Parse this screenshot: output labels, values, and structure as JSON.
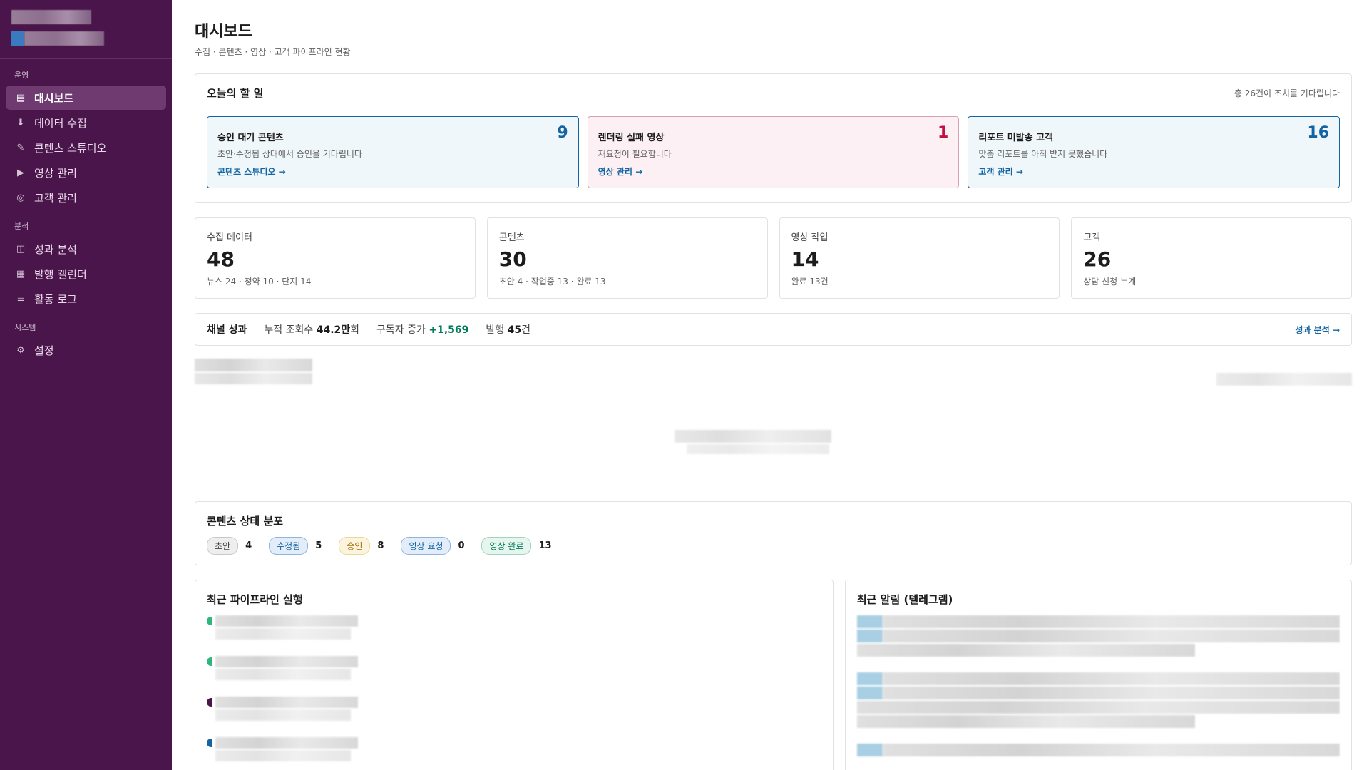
{
  "sidebar": {
    "sections": [
      {
        "label": "운영",
        "items": [
          {
            "id": "dashboard",
            "label": "대시보드",
            "icon": "dashboard-icon",
            "glyph": "▤",
            "active": true
          },
          {
            "id": "data",
            "label": "데이터 수집",
            "icon": "download-icon",
            "glyph": "⬇"
          },
          {
            "id": "content",
            "label": "콘텐츠 스튜디오",
            "icon": "pencil-icon",
            "glyph": "✎"
          },
          {
            "id": "video",
            "label": "영상 관리",
            "icon": "play-icon",
            "glyph": "▶"
          },
          {
            "id": "customers",
            "label": "고객 관리",
            "icon": "target-icon",
            "glyph": "◎"
          }
        ]
      },
      {
        "label": "분석",
        "items": [
          {
            "id": "analytics",
            "label": "성과 분석",
            "icon": "columns-icon",
            "glyph": "◫"
          },
          {
            "id": "calendar",
            "label": "발행 캘린더",
            "icon": "calendar-icon",
            "glyph": "▦"
          },
          {
            "id": "log",
            "label": "활동 로그",
            "icon": "list-icon",
            "glyph": "≡"
          }
        ]
      },
      {
        "label": "시스템",
        "items": [
          {
            "id": "settings",
            "label": "설정",
            "icon": "gear-icon",
            "glyph": "⚙"
          }
        ]
      }
    ]
  },
  "header": {
    "title": "대시보드",
    "subtitle": "수집 · 콘텐츠 · 영상 · 고객 파이프라인 현황"
  },
  "todo": {
    "title": "오늘의 할 일",
    "summary": "총 26건이 조치를 기다립니다",
    "cards": [
      {
        "title": "승인 대기 콘텐츠",
        "count": "9",
        "desc": "초안·수정됨 상태에서 승인을 기다립니다",
        "link": "콘텐츠 스튜디오 →",
        "tone": "blue"
      },
      {
        "title": "렌더링 실패 영상",
        "count": "1",
        "desc": "재요청이 필요합니다",
        "link": "영상 관리 →",
        "tone": "red"
      },
      {
        "title": "리포트 미발송 고객",
        "count": "16",
        "desc": "맞춤 리포트를 아직 받지 못했습니다",
        "link": "고객 관리 →",
        "tone": "blue"
      }
    ]
  },
  "stats": [
    {
      "label": "수집 데이터",
      "value": "48",
      "detail": "뉴스 24 · 청약 10 · 단지 14"
    },
    {
      "label": "콘텐츠",
      "value": "30",
      "detail": "초안 4 · 작업중 13 · 완료 13"
    },
    {
      "label": "영상 작업",
      "value": "14",
      "detail": "완료 13건"
    },
    {
      "label": "고객",
      "value": "26",
      "detail": "상담 신청 누계"
    }
  ],
  "channel": {
    "title": "채널 성과",
    "views_label": "누적 조회수",
    "views_value": "44.2만",
    "views_unit": "회",
    "subs_label": "구독자 증가",
    "subs_value": "+1,569",
    "pub_label": "발행",
    "pub_value": "45",
    "pub_unit": "건",
    "link": "성과 분석 →"
  },
  "distribution": {
    "title": "콘텐츠 상태 분포",
    "items": [
      {
        "label": "초안",
        "count": "4",
        "cls": "b-draft"
      },
      {
        "label": "수정됨",
        "count": "5",
        "cls": "b-revised"
      },
      {
        "label": "승인",
        "count": "8",
        "cls": "b-approved"
      },
      {
        "label": "영상 요청",
        "count": "0",
        "cls": "b-vreq"
      },
      {
        "label": "영상 완료",
        "count": "13",
        "cls": "b-vdone"
      }
    ]
  },
  "pipeline": {
    "title": "최근 파이프라인 실행",
    "status_colors": [
      "#2eb67d",
      "#2eb67d",
      "#4a154b",
      "#1264a3"
    ]
  },
  "alerts": {
    "title": "최근 알림 (텔레그램)"
  }
}
